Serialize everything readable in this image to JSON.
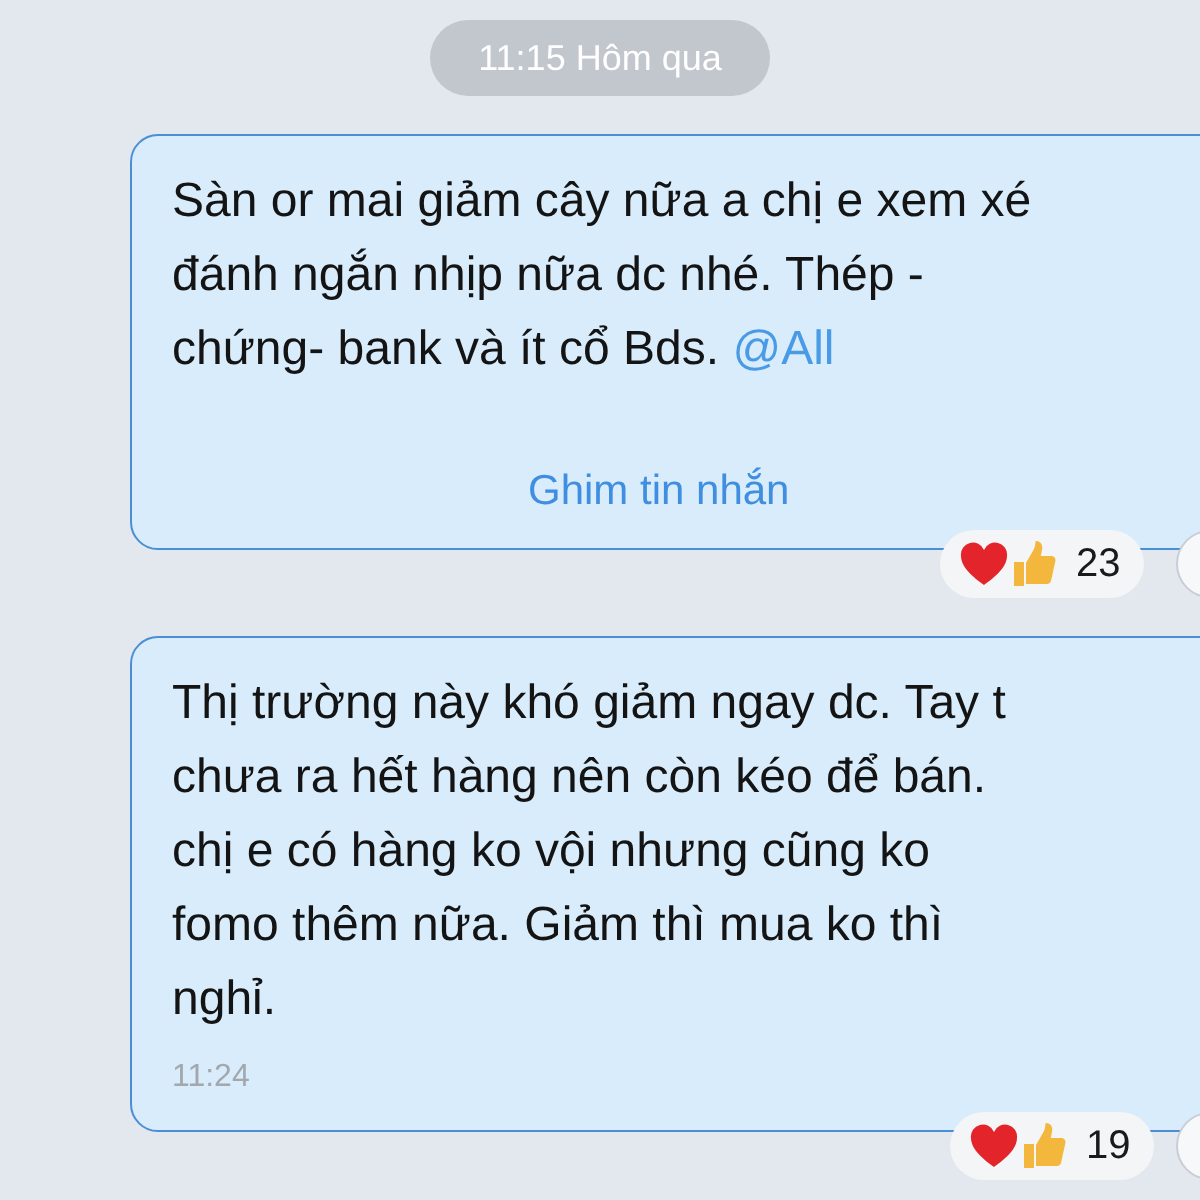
{
  "date_chip": {
    "text": "11:15 Hôm qua"
  },
  "messages": [
    {
      "text": "Sàn or mai giảm cây nữa a chị e xem xé\nđánh ngắn nhịp nữa dc nhé. Thép -\nchứng- bank và ít cổ Bds.",
      "mention": "@All",
      "action": "Ghim tin nhắn",
      "reactions": {
        "count": "23"
      }
    },
    {
      "text": "Thị trường này khó giảm ngay dc. Tay t\nchưa ra hết hàng nên còn kéo để bán.\nchị e có hàng ko vội nhưng cũng ko\nfomo thêm nữa. Giảm thì mua ko thì\nnghỉ.",
      "time": "11:24",
      "reactions": {
        "count": "19"
      }
    }
  ]
}
